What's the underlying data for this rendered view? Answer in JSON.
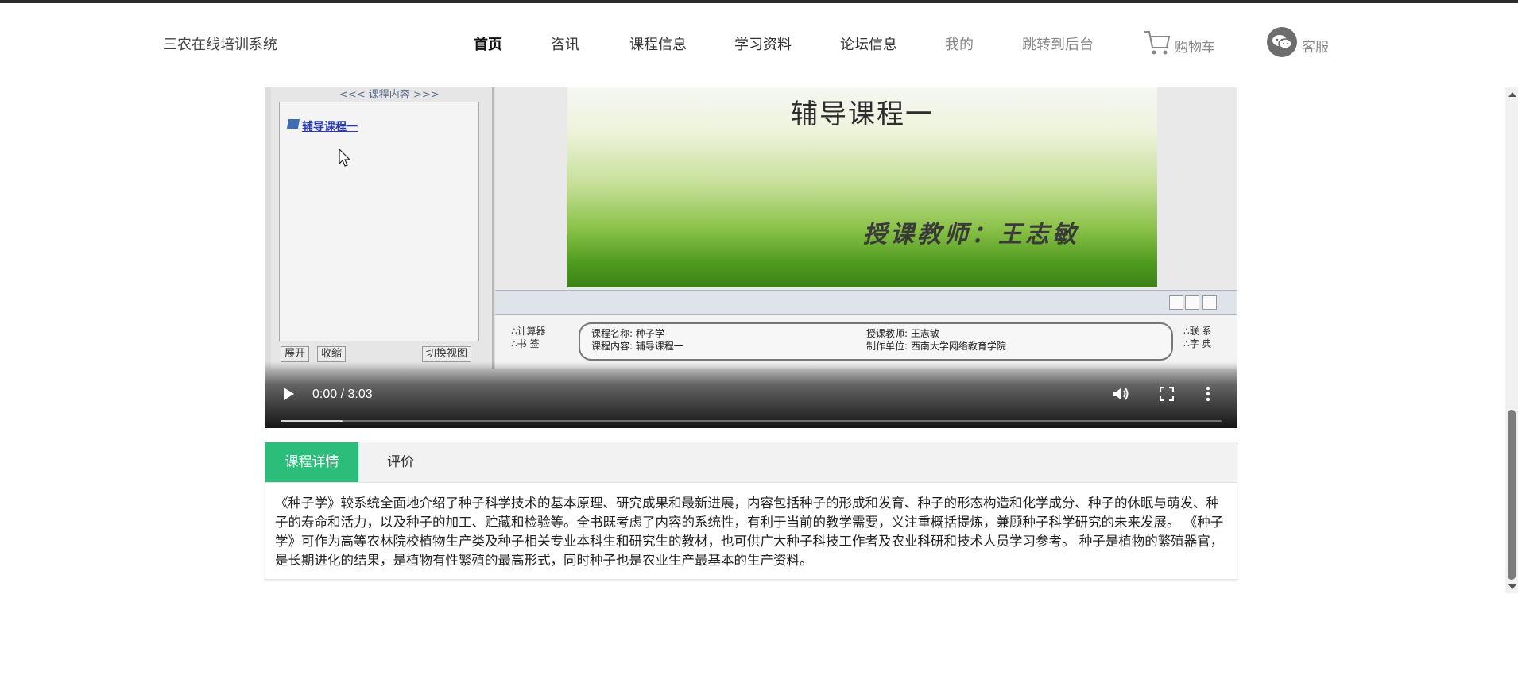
{
  "header": {
    "brand": "三农在线培训系统",
    "nav": [
      {
        "label": "首页"
      },
      {
        "label": "咨讯"
      },
      {
        "label": "课程信息"
      },
      {
        "label": "学习资料"
      },
      {
        "label": "论坛信息"
      },
      {
        "label": "我的"
      },
      {
        "label": "跳转到后台"
      }
    ],
    "cart_label": "购物车",
    "service_label": "客服"
  },
  "video": {
    "panel_title": "<<< 课程内容 >>>",
    "tree_item": "辅导课程一",
    "btn_expand": "展开",
    "btn_collapse": "收缩",
    "btn_switch": "切换视图",
    "slide_title": "辅导课程一",
    "slide_teacher": "授课教师：王志敏",
    "left_labels": [
      "∴计算器",
      "∴书 签"
    ],
    "right_labels": [
      "∴联 系",
      "∴字 典"
    ],
    "course_name": "课程名称: 种子学",
    "course_content": "课程内容: 辅导课程一",
    "teacher": "授课教师: 王志敏",
    "producer": "制作单位: 西南大学网络教育学院",
    "time_display": "0:00 / 3:03",
    "buffered_fraction": 0.066
  },
  "tabs": {
    "items": [
      {
        "label": "课程详情"
      },
      {
        "label": "评价"
      }
    ],
    "content": "《种子学》较系统全面地介绍了种子科学技术的基本原理、研究成果和最新进展，内容包括种子的形成和发育、种子的形态构造和化学成分、种子的休眠与萌发、种子的寿命和活力，以及种子的加工、贮藏和检验等。全书既考虑了内容的系统性，有利于当前的教学需要，义注重概括提炼，兼顾种子科学研究的未来发展。 《种子学》可作为高等农林院校植物生产类及种子相关专业本科生和研究生的教材，也可供广大种子科技工作者及农业科研和技术人员学习参考。 种子是植物的繁殖器官，是长期进化的结果，是植物有性繁殖的最高形式，同时种子也是农业生产最基本的生产资料。"
  },
  "colors": {
    "accent": "#2dbd7b"
  }
}
